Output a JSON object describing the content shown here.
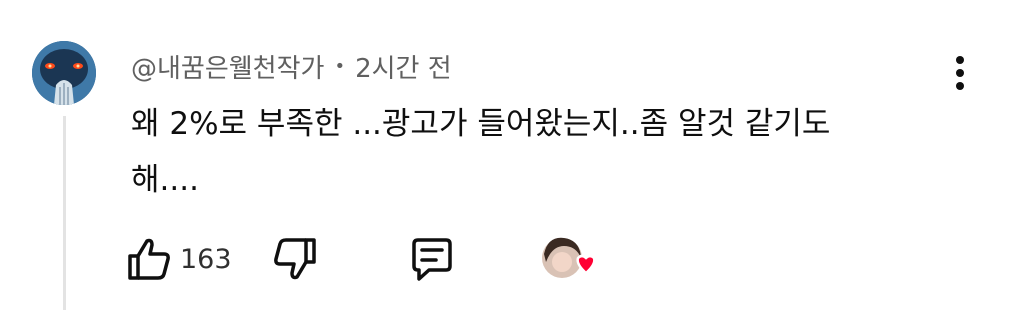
{
  "comment": {
    "author": "@내꿈은웰천작가",
    "separator": "•",
    "time": "2시간 전",
    "text": "왜 2%로 부족한 ...광고가 들어왔는지..좀 알것 같기도\n해....",
    "like_count": "163"
  },
  "icons": {
    "avatar": "alien-avatar-image",
    "more": "more-vert-icon",
    "like": "thumb-up-icon",
    "dislike": "thumb-down-icon",
    "reply": "reply-icon",
    "creator_heart": "creator-heart-avatar"
  },
  "colors": {
    "heart": "#ff0033",
    "text_secondary": "#606060",
    "text_primary": "#0f0f0f"
  }
}
